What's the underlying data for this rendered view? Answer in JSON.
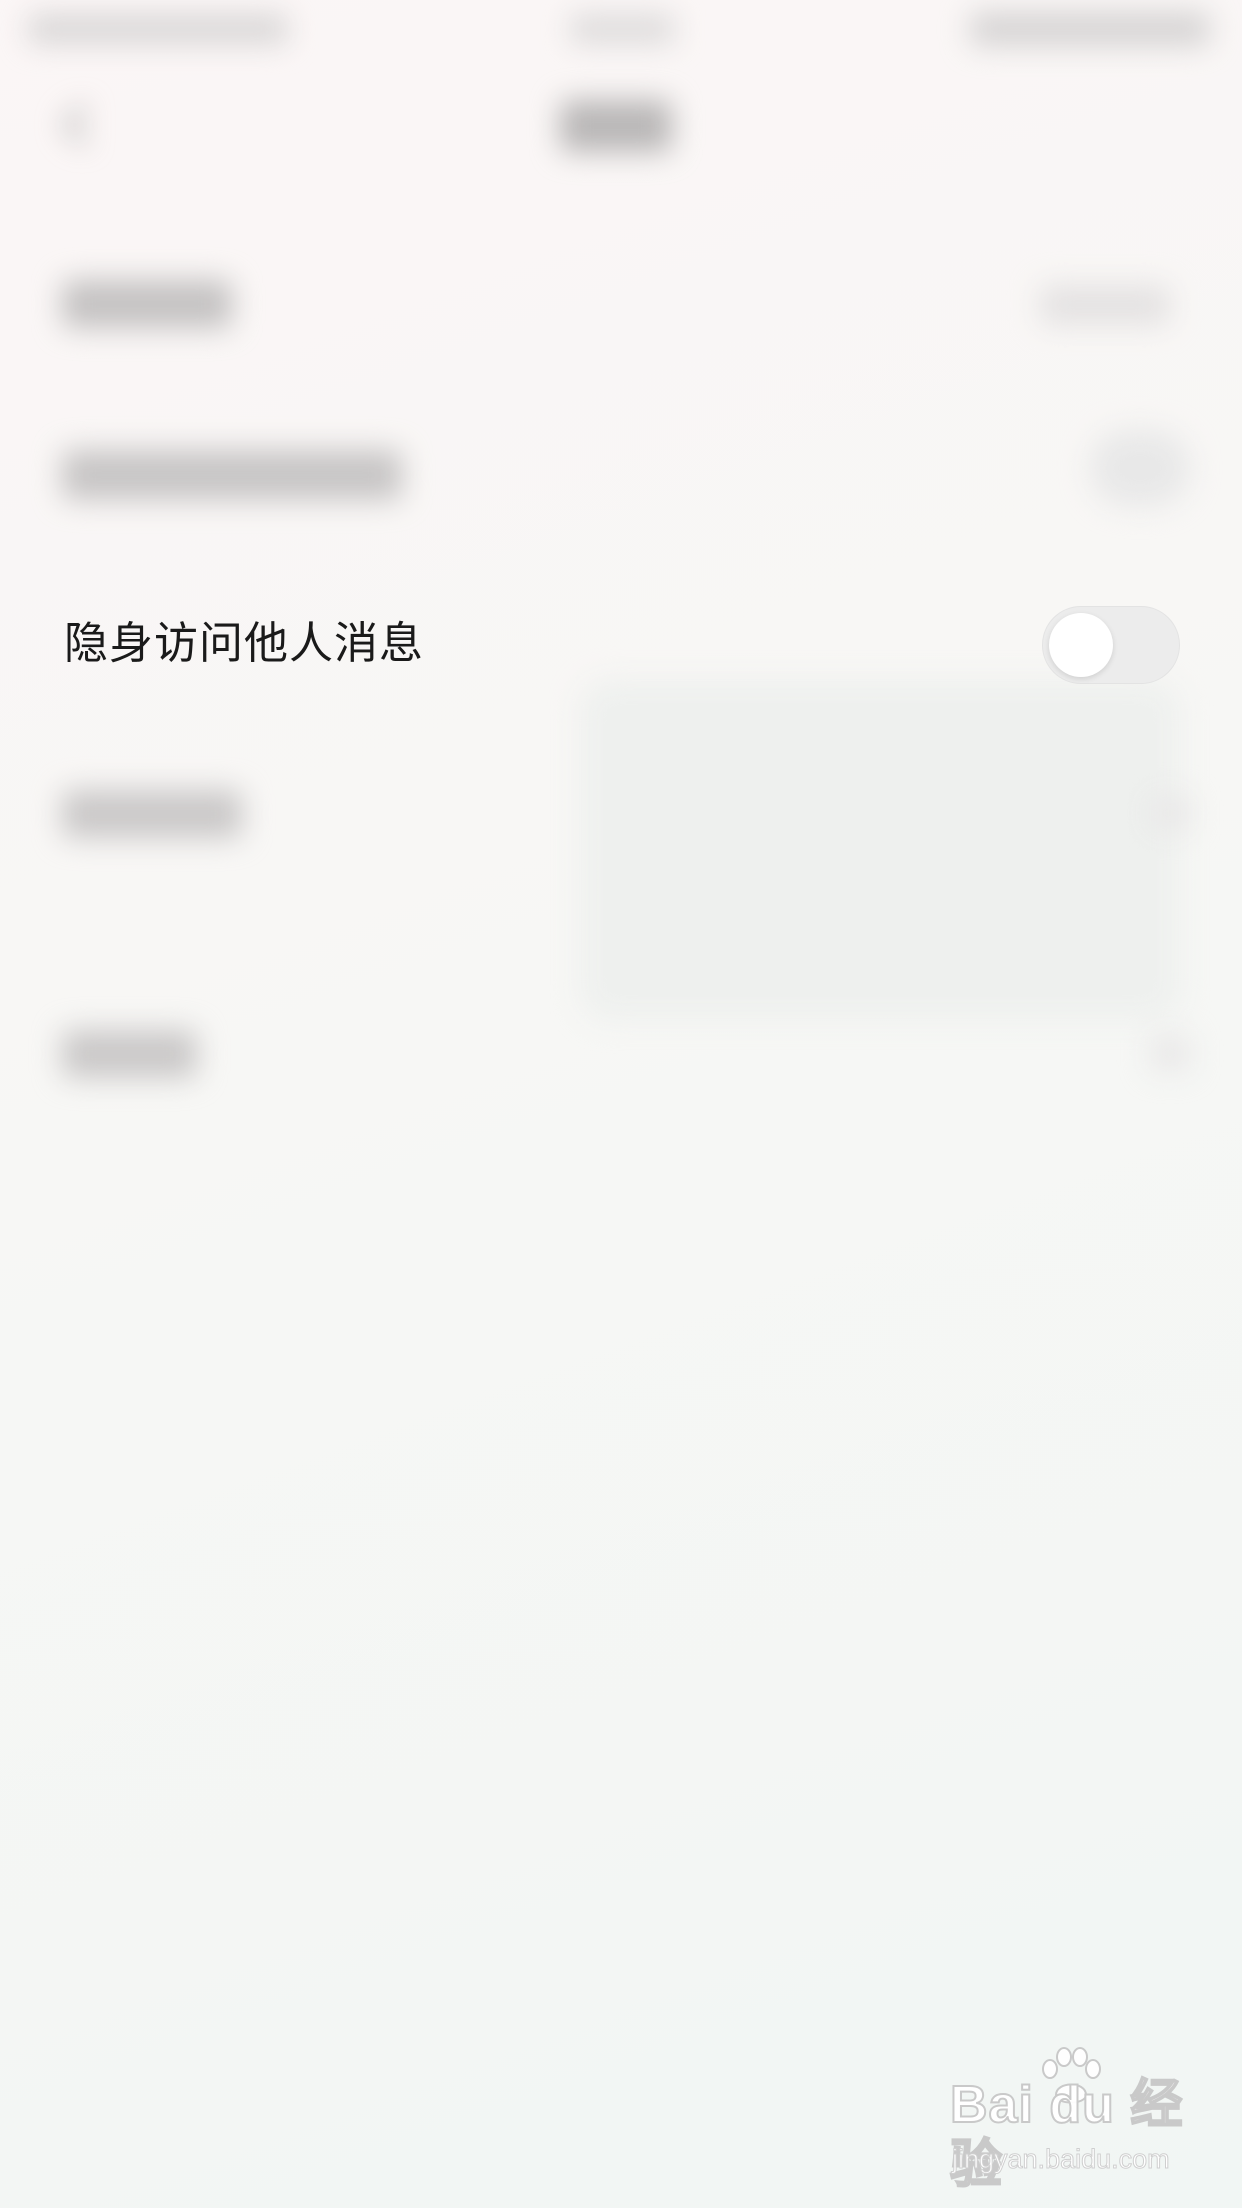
{
  "settings": {
    "incognito_label": "隐身访问他人消息",
    "incognito_enabled": false
  },
  "watermark": {
    "brand": "Bai du 经验",
    "url": "jingyan.baidu.com"
  },
  "colors": {
    "toggle_off_track": "#ececec",
    "toggle_knob": "#ffffff",
    "label_text": "#1a1a1a"
  }
}
